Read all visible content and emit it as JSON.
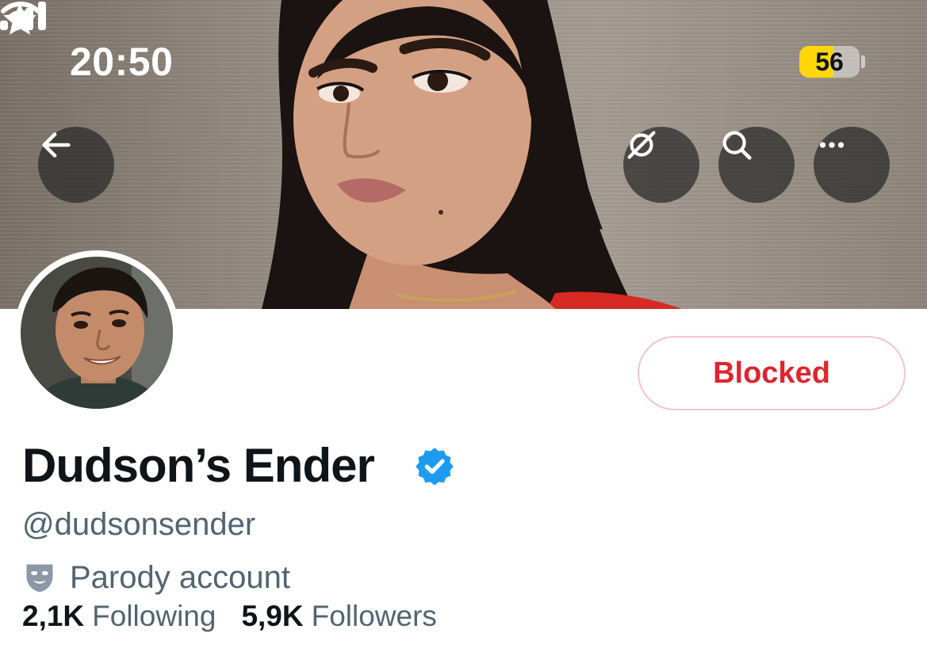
{
  "status_bar": {
    "time": "20:50",
    "battery_level": "56",
    "battery_percent": 56
  },
  "profile": {
    "display_name": "Dudson’s Ender",
    "handle": "@dudsonsender",
    "parody_label": "Parody account",
    "following_count": "2,1K",
    "following_label": "Following",
    "followers_count": "5,9K",
    "followers_label": "Followers"
  },
  "actions": {
    "blocked_label": "Blocked"
  },
  "icons": {
    "back": "arrow-left-icon",
    "grok": "grok-icon",
    "search": "search-icon",
    "more": "more-horizontal-icon",
    "verified": "verified-badge-icon",
    "parody": "theater-mask-icon",
    "status_star": "star-icon",
    "signal": "cellular-signal-icon",
    "wifi": "wifi-icon"
  },
  "colors": {
    "blocked_red": "#e0242e",
    "blocked_border": "#f6c3c9",
    "verified_blue": "#1d9bf0",
    "secondary_text": "#536471",
    "primary_text": "#0f1419",
    "battery_yellow": "#ffd60a"
  }
}
